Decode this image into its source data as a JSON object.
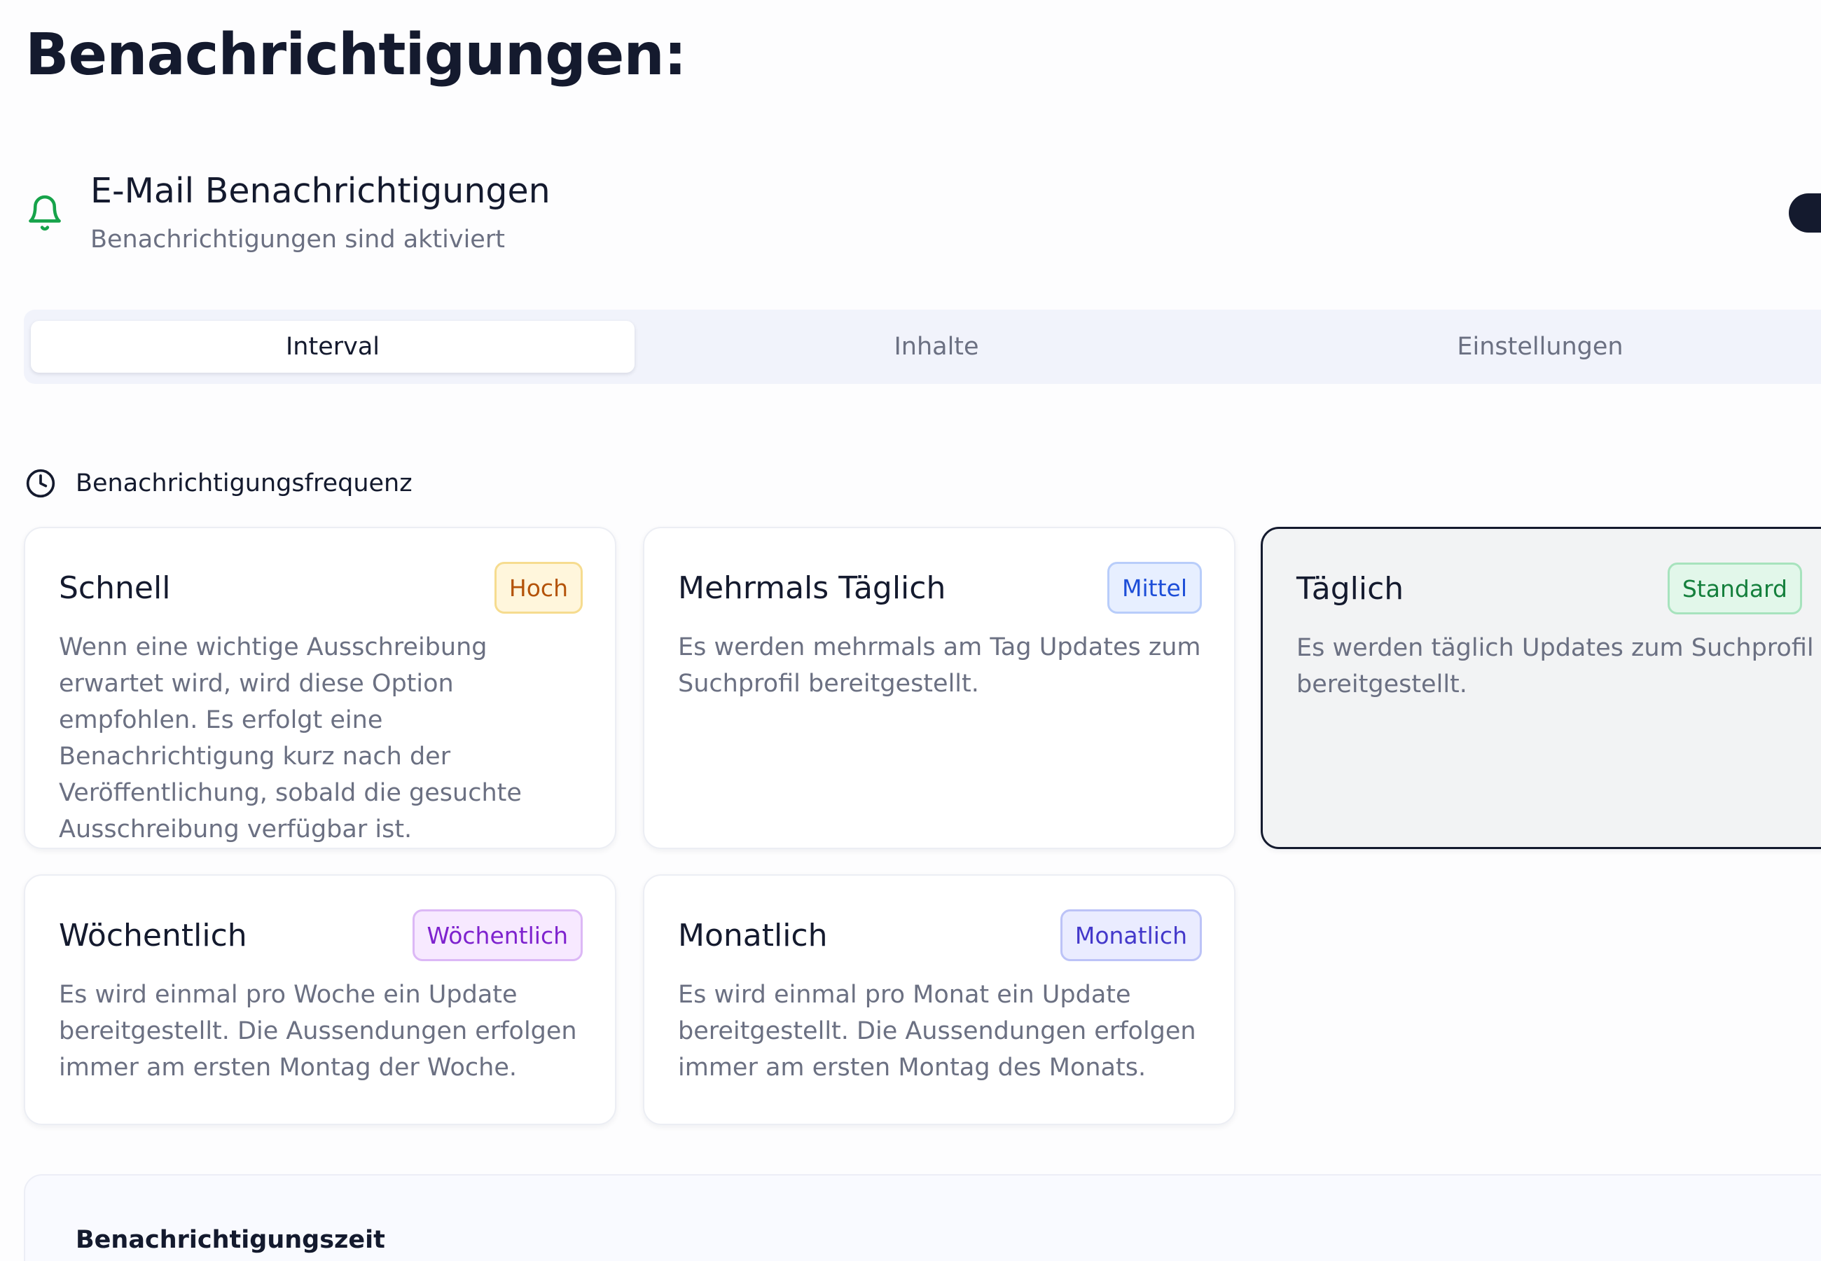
{
  "page": {
    "title": "Benachrichtigungen:"
  },
  "email_notifications": {
    "title": "E-Mail Benachrichtigungen",
    "status": "Benachrichtigungen sind aktiviert",
    "enabled": true,
    "icon": "bell-icon",
    "icon_color": "#16a34a"
  },
  "tabs": [
    {
      "label": "Interval",
      "active": true
    },
    {
      "label": "Inhalte",
      "active": false
    },
    {
      "label": "Einstellungen",
      "active": false
    }
  ],
  "frequency": {
    "heading": "Benachrichtigungsfrequenz",
    "icon": "clock-icon",
    "options": [
      {
        "title": "Schnell",
        "badge": "Hoch",
        "description": "Wenn eine wichtige Ausschreibung erwartet wird, wird diese Option empfohlen. Es erfolgt eine Benachrichtigung kurz nach der Veröffentlichung, sobald die gesuchte Ausschreibung verfügbar ist.",
        "selected": false
      },
      {
        "title": "Mehrmals Täglich",
        "badge": "Mittel",
        "description": "Es werden mehrmals am Tag Updates zum Suchprofil bereitgestellt.",
        "selected": false
      },
      {
        "title": "Täglich",
        "badge": "Standard",
        "description": "Es werden täglich Updates zum Suchprofil bereitgestellt.",
        "selected": true
      },
      {
        "title": "Wöchentlich",
        "badge": "Wöchentlich",
        "description": "Es wird einmal pro Woche ein Update bereitgestellt. Die Aussendungen erfolgen immer am ersten Montag der Woche.",
        "selected": false
      },
      {
        "title": "Monatlich",
        "badge": "Monatlich",
        "description": "Es wird einmal pro Monat ein Update bereitgestellt. Die Aussendungen erfolgen immer am ersten Montag des Monats.",
        "selected": false
      }
    ]
  },
  "notification_time": {
    "heading": "Benachrichtigungszeit"
  },
  "colors": {
    "text_primary": "#141a2e",
    "text_muted": "#6b7082",
    "selected_border": "#141a2e",
    "tab_background": "#f1f3fb"
  }
}
